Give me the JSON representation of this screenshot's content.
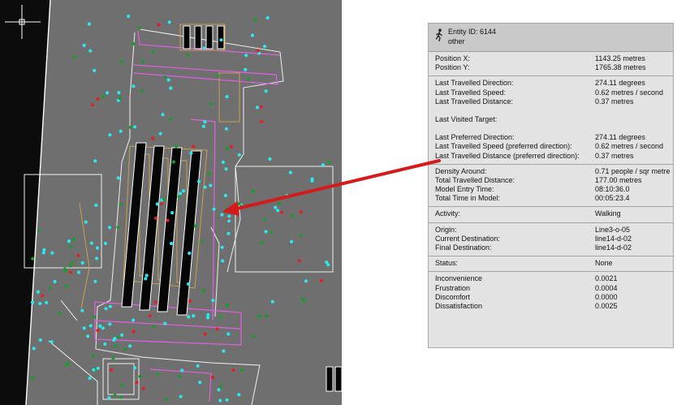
{
  "entity": {
    "id_label": "Entity ID: 6144",
    "type": "other"
  },
  "position": [
    {
      "label": "Position X:",
      "value": "1143.25 metres"
    },
    {
      "label": "Position Y:",
      "value": "1765.38 metres"
    }
  ],
  "travel": [
    {
      "label": "Last Travelled Direction:",
      "value": "274.11 degrees"
    },
    {
      "label": "Last Travelled Speed:",
      "value": "0.62 metres / second"
    },
    {
      "label": "Last Travelled Distance:",
      "value": "0.37 metres"
    }
  ],
  "target": {
    "label": "Last Visited Target:"
  },
  "preferred": [
    {
      "label": "Last Preferred Direction:",
      "value": "274.11 degrees"
    },
    {
      "label": "Last Travelled Speed (preferred direction):",
      "value": "0.62 metres / second"
    },
    {
      "label": "Last Travelled Distance (preferred direction):",
      "value": "0.37 metres"
    }
  ],
  "density": [
    {
      "label": "Density Around:",
      "value": "0.71 people / sqr metre"
    },
    {
      "label": "Total Travelled Distance:",
      "value": "177.00 metres"
    },
    {
      "label": "Model Entry Time:",
      "value": "08:10:36.0"
    },
    {
      "label": "Total Time in Model:",
      "value": "00:05:23.4"
    }
  ],
  "activity": {
    "label": "Activity:",
    "value": "Walking"
  },
  "destinations": [
    {
      "label": "Origin:",
      "value": "Line3-o-05"
    },
    {
      "label": "Current Destination:",
      "value": "line14-d-02"
    },
    {
      "label": "Final Destination:",
      "value": "line14-d-02"
    }
  ],
  "status": {
    "label": "Status:",
    "value": "None"
  },
  "metrics": [
    {
      "label": "Inconvenience",
      "value": "0.0021"
    },
    {
      "label": "Frustration",
      "value": "0.0004"
    },
    {
      "label": "Discomfort",
      "value": "0.0000"
    },
    {
      "label": "Dissatisfaction",
      "value": "0.0025"
    }
  ],
  "colors": {
    "background": "#6f6f6f",
    "pedestrian_cyan": "#2ee6ef",
    "pedestrian_green": "#1c9a2e",
    "pedestrian_red": "#e0202a",
    "wall_magenta": "#e060e0",
    "wall_white": "#f0f0f0",
    "stair_tan": "#c8a050",
    "pointer_arrow": "#d51a1a"
  },
  "icons": {
    "entity": "walking-person-icon",
    "cursor": "crosshair-icon"
  }
}
